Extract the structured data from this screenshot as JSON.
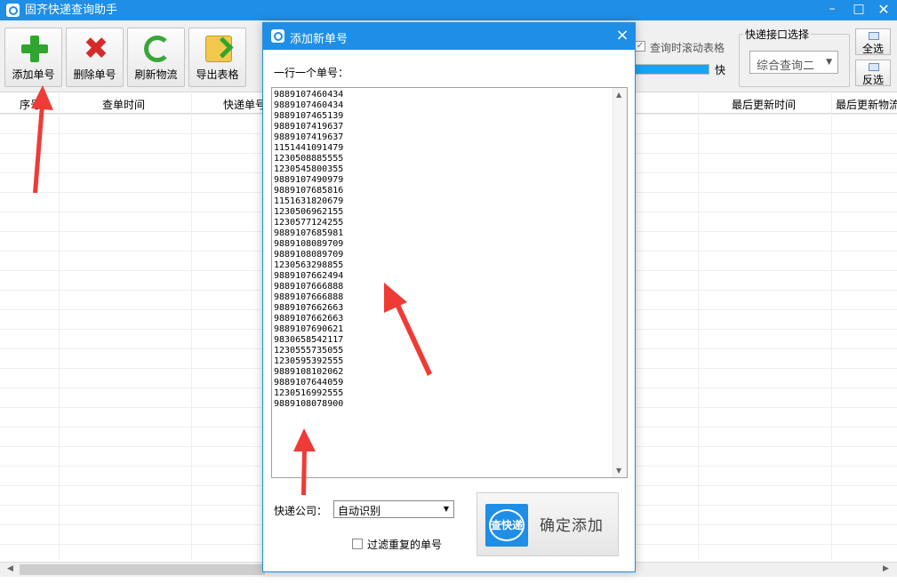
{
  "app": {
    "title": "固齐快递查询助手"
  },
  "window_controls": {
    "minimize": "–",
    "maximize": "□",
    "close": "✕"
  },
  "toolbar": {
    "buttons": [
      {
        "label": "添加单号",
        "icon": "add-icon"
      },
      {
        "label": "删除单号",
        "icon": "delete-icon"
      },
      {
        "label": "刷新物流",
        "icon": "refresh-icon"
      },
      {
        "label": "导出表格",
        "icon": "export-icon"
      }
    ],
    "scroll_checkbox_label": "查询时滚动表格",
    "scroll_checkbox_checked": true,
    "speed_label": "快",
    "speed_level": 1.0,
    "api_group_label": "快递接口选择",
    "api_selected": "综合查询二",
    "select_all_label": "全选",
    "invert_label": "反选"
  },
  "grid": {
    "columns": [
      "序号",
      "查单时间",
      "快递单号",
      "最后更新时间",
      "最后更新物流"
    ]
  },
  "dialog": {
    "title": "添加新单号",
    "close_label": "×",
    "instruction": "一行一个单号：",
    "tracking_numbers": [
      "9889107460434",
      "9889107460434",
      "9889107465139",
      "9889107419637",
      "9889107419637",
      "1151441091479",
      "1230508885555",
      "1230545800355",
      "9889107490979",
      "9889107685816",
      "1151631820679",
      "1230506962155",
      "1230577124255",
      "9889107685981",
      "9889108089709",
      "9889108089709",
      "1230563298855",
      "9889107662494",
      "9889107666888",
      "9889107666888",
      "9889107662663",
      "9889107662663",
      "9889107690621",
      "9830658542117",
      "1230555735055",
      "1230595392555",
      "9889108102062",
      "9889107644059",
      "1230516992555",
      "9889108078900"
    ],
    "company_label": "快递公司：",
    "company_selected": "自动识别",
    "dedupe_label": "过滤重复的单号",
    "dedupe_checked": false,
    "logo_text": "查快递",
    "confirm_label": "确定添加"
  },
  "colors": {
    "titlebar": "#1e8ee6",
    "accent": "#1e8ee6",
    "annotation_arrow": "#ef3b36"
  }
}
